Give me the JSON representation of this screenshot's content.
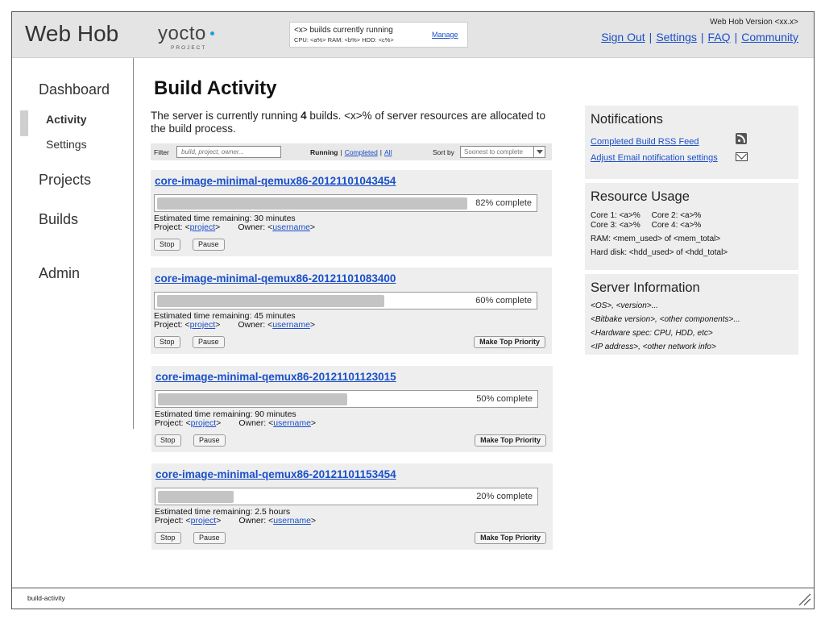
{
  "header": {
    "app_title": "Web Hob",
    "logo_word": "yocto",
    "logo_sub": "PROJECT",
    "status_line1": "<x> builds currently running",
    "status_line2": "CPU: <a%>   RAM: <b%>   HDD: <c%>",
    "manage_label": "Manage",
    "version": "Web Hob Version <xx.x>",
    "links": [
      "Sign Out",
      "Settings",
      "FAQ",
      "Community"
    ],
    "link_sep": "|"
  },
  "nav": {
    "dashboard": "Dashboard",
    "activity": "Activity",
    "settings": "Settings",
    "projects": "Projects",
    "builds": "Builds",
    "admin": "Admin"
  },
  "main": {
    "title": "Build Activity",
    "intro_pre": "The server is currently running ",
    "intro_count": "4",
    "intro_post": " builds. <x>% of server resources are allocated to the build process.",
    "filter": {
      "label": "Filter",
      "placeholder": "build, project, owner...",
      "tabs": [
        "Running",
        "Completed",
        "All"
      ],
      "tab_sep": "|",
      "sort_label": "Sort by",
      "sort_value": "Soonest to complete"
    },
    "builds": [
      {
        "name": "core-image-minimal-qemux86-20121101043454",
        "progress": 0.82,
        "progress_text": "82% complete",
        "eta": "Estimated time remaining: 30 minutes",
        "project_label": "Project: <",
        "project": "project",
        "project_close": ">",
        "owner_label": "Owner: <",
        "owner": "username",
        "owner_close": ">",
        "stop": "Stop",
        "pause": "Pause",
        "priority": ""
      },
      {
        "name": "core-image-minimal-qemux86-20121101083400",
        "progress": 0.6,
        "progress_text": "60% complete",
        "eta": "Estimated time remaining: 45 minutes",
        "project_label": "Project: <",
        "project": "project",
        "project_close": ">",
        "owner_label": "Owner: <",
        "owner": "username",
        "owner_close": ">",
        "stop": "Stop",
        "pause": "Pause",
        "priority": "Make Top Priority"
      },
      {
        "name": "core-image-minimal-qemux86-20121101123015",
        "progress": 0.5,
        "progress_text": "50% complete",
        "eta": "Estimated time remaining: 90 minutes",
        "project_label": "Project: <",
        "project": "project",
        "project_close": ">",
        "owner_label": "Owner: <",
        "owner": "username",
        "owner_close": ">",
        "stop": "Stop",
        "pause": "Pause",
        "priority": "Make Top Priority"
      },
      {
        "name": "core-image-minimal-qemux86-20121101153454",
        "progress": 0.2,
        "progress_text": "20% complete",
        "eta": "Estimated time remaining: 2.5 hours",
        "project_label": "Project: <",
        "project": "project",
        "project_close": ">",
        "owner_label": "Owner: <",
        "owner": "username",
        "owner_close": ">",
        "stop": "Stop",
        "pause": "Pause",
        "priority": "Make Top Priority"
      }
    ]
  },
  "notifications": {
    "title": "Notifications",
    "rss_link": "Completed Build RSS Feed",
    "email_link": "Adjust Email notification settings",
    "rss_icon": "rss-icon",
    "mail_icon": "mail-icon"
  },
  "resources": {
    "title": "Resource Usage",
    "cores_line1": "Core 1: <a>%     Core 2: <a>%",
    "cores_line2": "Core 3: <a>%     Core 4: <a>%",
    "ram": "RAM: <mem_used> of <mem_total>",
    "disk": "Hard disk: <hdd_used> of <hdd_total>"
  },
  "server": {
    "title": "Server Information",
    "line1": "<OS>, <version>...",
    "line2": "<Bitbake version>, <other components>...",
    "line3": "<Hardware spec: CPU, HDD, etc>",
    "line4": "<IP address>, <other network info>"
  },
  "footer": {
    "label": "build-activity"
  }
}
